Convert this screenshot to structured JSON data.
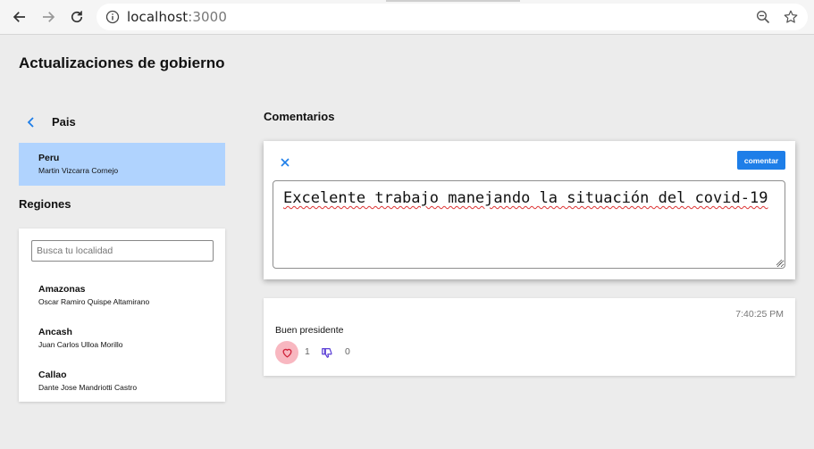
{
  "browser": {
    "url_host": "localhost",
    "url_port": ":3000",
    "icons": [
      "back-icon",
      "forward-icon",
      "reload-icon",
      "info-icon",
      "zoom-icon",
      "star-icon"
    ]
  },
  "page": {
    "title": "Actualizaciones de gobierno"
  },
  "country": {
    "section_label": "Pais",
    "selected": {
      "name": "Peru",
      "leader": "Martin Vizcarra Cornejo"
    }
  },
  "regions": {
    "title": "Regiones",
    "search_placeholder": "Busca tu localidad",
    "items": [
      {
        "name": "Amazonas",
        "leader": "Oscar Ramiro Quispe Altamirano"
      },
      {
        "name": "Ancash",
        "leader": "Juan Carlos Ulloa Morillo"
      },
      {
        "name": "Callao",
        "leader": "Dante Jose Mandriotti Castro"
      }
    ]
  },
  "comments": {
    "title": "Comentarios",
    "submit_label": "comentar",
    "draft_text": "Excelente trabajo manejando la situación del covid-19",
    "list": [
      {
        "time": "7:40:25 PM",
        "body": "Buen presidente",
        "likes": "1",
        "dislikes": "0"
      }
    ]
  },
  "colors": {
    "accent": "#1e7ee8",
    "selected_bg": "#b0d3fe",
    "like_bg": "#f8b7c0",
    "like_icon": "#d0233a",
    "dislike_icon": "#5b3fd6"
  }
}
